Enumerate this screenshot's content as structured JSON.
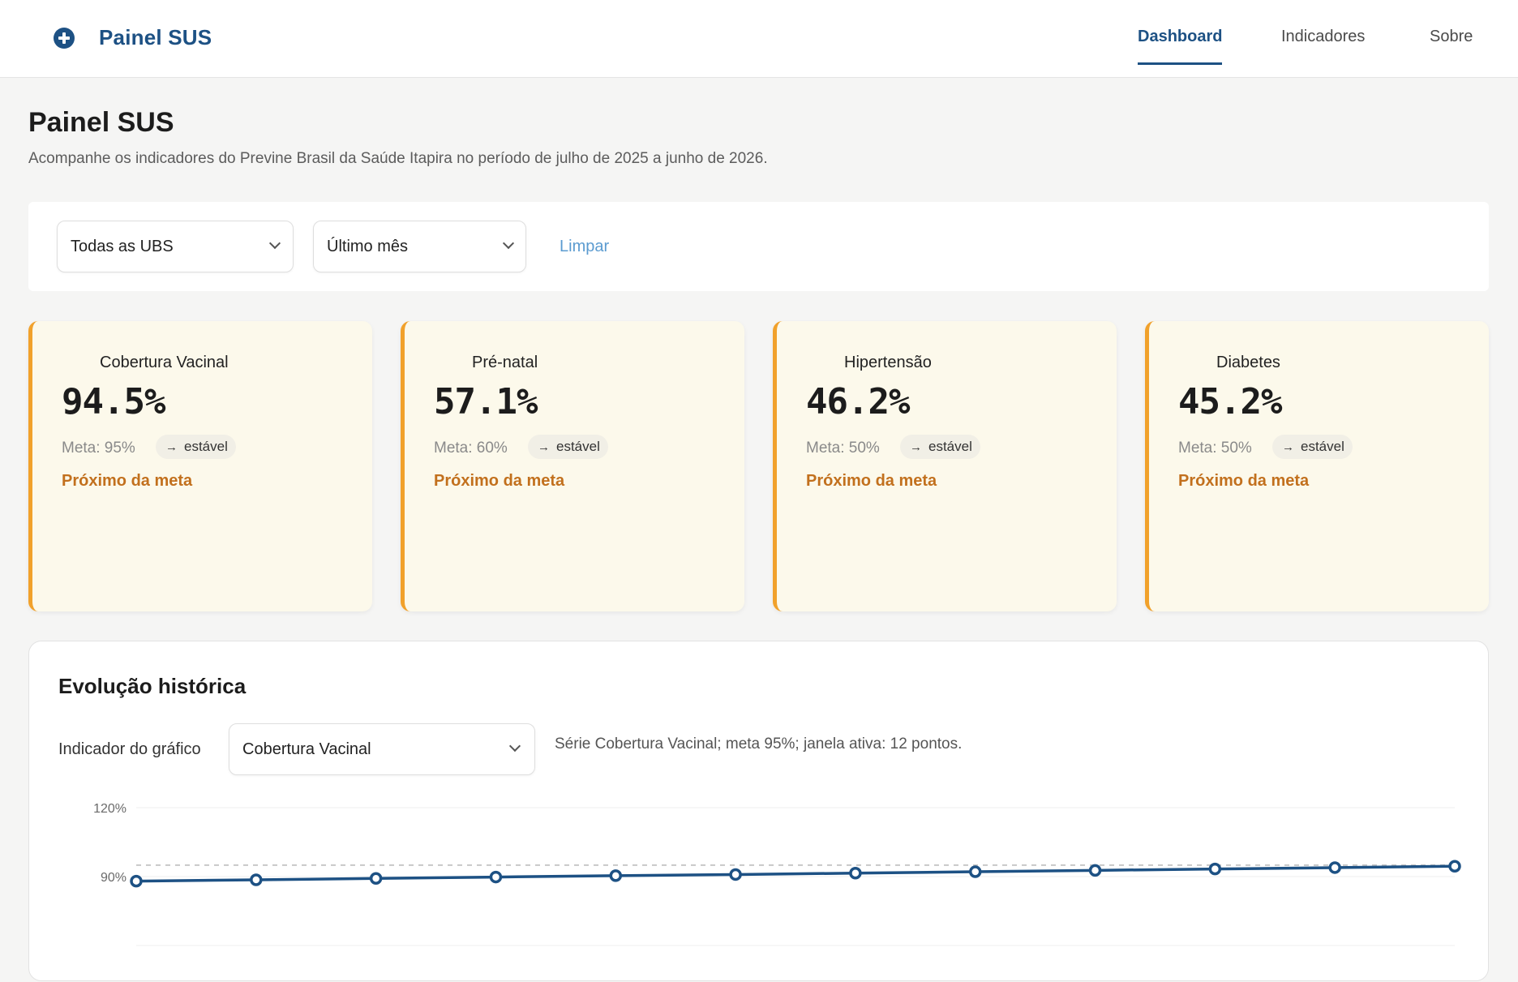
{
  "header": {
    "brand": "Painel SUS",
    "brand_icon": "plus-circle-icon",
    "nav": [
      {
        "label": "Dashboard",
        "active": true
      },
      {
        "label": "Indicadores",
        "active": false
      },
      {
        "label": "Sobre",
        "active": false
      }
    ]
  },
  "page": {
    "title": "Painel SUS",
    "subtitle": "Acompanhe os indicadores do Previne Brasil da Saúde Itapira no período de julho de 2025 a junho de 2026."
  },
  "filters": {
    "ubs_value": "Todas as UBS",
    "period_value": "Último mês",
    "clear_label": "Limpar"
  },
  "cards": [
    {
      "title": "Cobertura Vacinal",
      "value": "94.5%",
      "meta": "Meta: 95%",
      "trend": "estável",
      "status": "Próximo da meta"
    },
    {
      "title": "Pré-natal",
      "value": "57.1%",
      "meta": "Meta: 60%",
      "trend": "estável",
      "status": "Próximo da meta"
    },
    {
      "title": "Hipertensão",
      "value": "46.2%",
      "meta": "Meta: 50%",
      "trend": "estável",
      "status": "Próximo da meta"
    },
    {
      "title": "Diabetes",
      "value": "45.2%",
      "meta": "Meta: 50%",
      "trend": "estável",
      "status": "Próximo da meta"
    }
  ],
  "colors": {
    "brand": "#1d5184",
    "card_accent": "#f1a12b",
    "status_text": "#c2701d",
    "card_bg": "#fcf9eb"
  },
  "chart_panel": {
    "heading": "Evolução histórica",
    "indicator_label": "Indicador do gráfico",
    "indicator_value": "Cobertura Vacinal",
    "note": "Série Cobertura Vacinal; meta 95%; janela ativa: 12 pontos."
  },
  "chart_data": {
    "type": "line",
    "title": "",
    "xlabel": "",
    "ylabel": "",
    "y_ticks": [
      "120%",
      "90%"
    ],
    "ylim": [
      60,
      120
    ],
    "target_line": 95,
    "series": [
      {
        "values": [
          88.0,
          88.6,
          89.2,
          89.8,
          90.4,
          90.9,
          91.5,
          92.1,
          92.7,
          93.3,
          93.9,
          94.5
        ]
      }
    ],
    "grid": true
  }
}
